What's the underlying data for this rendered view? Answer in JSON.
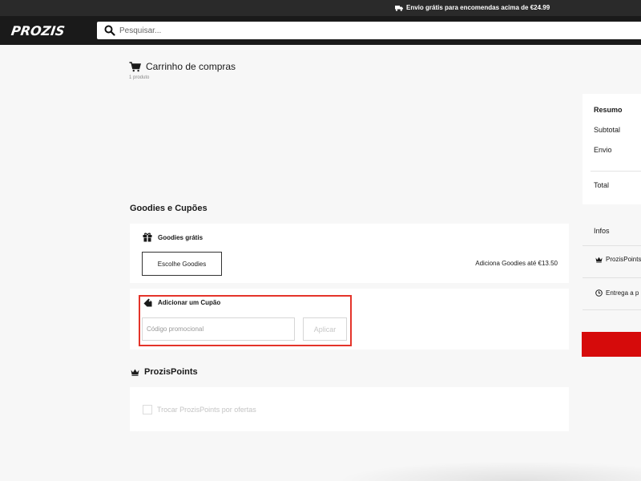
{
  "promo_bar": {
    "text": "Envio grátis para encomendas acima de €24.99"
  },
  "header": {
    "logo": "PROZIS",
    "search_placeholder": "Pesquisar..."
  },
  "cart": {
    "title": "Carrinho de compras",
    "count": "1 produto"
  },
  "goodies_section": {
    "title": "Goodies e Cupões",
    "goodies_label": "Goodies grátis",
    "choose_button": "Escolhe Goodies",
    "goodies_info": "Adiciona Goodies até €13.50",
    "coupon_label": "Adicionar um Cupão",
    "coupon_placeholder": "Código promocional",
    "apply_button": "Aplicar"
  },
  "points_section": {
    "title": "ProzisPoints",
    "checkbox_label": "Trocar ProzisPoints por ofertas"
  },
  "summary": {
    "title": "Resumo",
    "subtotal": "Subtotal",
    "shipping": "Envio",
    "total": "Total"
  },
  "infos": {
    "title": "Infos",
    "points_row": "ProzisPoints",
    "delivery_row": "Entrega a p"
  },
  "colors": {
    "accent_red": "#d60b0b",
    "highlight_red": "#e4342a",
    "header_bg": "#1a1a1a"
  }
}
